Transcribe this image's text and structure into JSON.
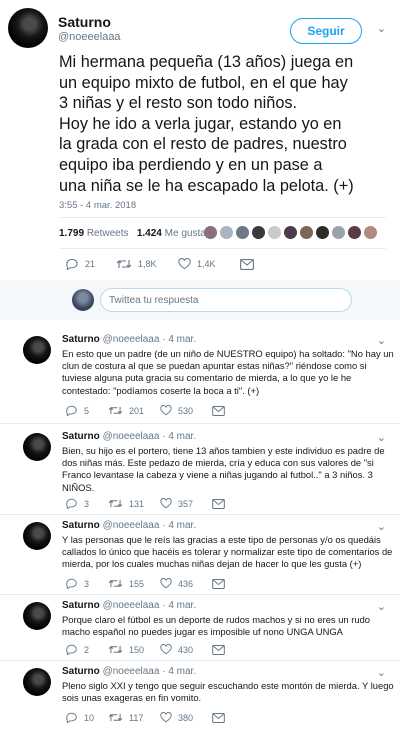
{
  "main_tweet": {
    "name": "Saturno",
    "handle": "@noeeelaaa",
    "follow_label": "Seguir",
    "text_lines": [
      "Mi hermana pequeña (13 años) juega en",
      "un equipo mixto de futbol, en el que hay",
      "3 niñas y el resto son todo niños.",
      "Hoy he ido a verla jugar, estando yo en",
      "la grada con el resto de padres, nuestro",
      "equipo iba perdiendo y en un pase a",
      "una niña se le ha escapado la pelota. (+)"
    ],
    "timestamp": "3:55 - 4 mar. 2018",
    "retweets_count": "1.799",
    "retweets_label": "Retweets",
    "likes_count": "1.424",
    "likes_label": "Me gusta",
    "liker_colors": [
      "#8a6f7d",
      "#a9b4c0",
      "#6b7a86",
      "#3a3a3a",
      "#c9c9c9",
      "#4d3b4a",
      "#7d6558",
      "#2c2c2c",
      "#9aa3ad",
      "#5a3c44",
      "#b08a80"
    ],
    "actions": {
      "replies": "21",
      "retweets": "1,8K",
      "likes": "1,4K"
    }
  },
  "reply_box": {
    "placeholder": "Twittea tu respuesta"
  },
  "replies": [
    {
      "name": "Saturno",
      "handle": "@noeeelaaa · 4 mar.",
      "lines": [
        "En esto que un padre (de un niño de NUESTRO equipo) ha soltado: \"No hay un",
        "clun de costura al que se puedan apuntar estas niñas?\" riéndose como si",
        "tuviese alguna puta gracia su comentario de mierda, a lo que yo le he",
        "contestado: \"podíamos coserte la boca a ti\". (+)"
      ],
      "replies": "5",
      "retweets": "201",
      "likes": "530"
    },
    {
      "name": "Saturno",
      "handle": "@noeeelaaa · 4 mar.",
      "lines": [
        "Bien, su hijo es el portero, tiene 13 años tambien y este individuo es padre de",
        "dos niñas más. Este pedazo de mierda, cría y educa con sus valores de \"si",
        "Franco levantase la cabeza y viene a niñas jugando al futbol..\" a 3 niños. 3",
        "NIÑOS."
      ],
      "replies": "3",
      "retweets": "131",
      "likes": "357"
    },
    {
      "name": "Saturno",
      "handle": "@noeeelaaa · 4 mar.",
      "lines": [
        "Y las personas que le reís las gracias a este tipo de personas y/o os quedáis",
        "callados lo único que hacéis es tolerar y normalizar este tipo de comentarios de",
        "mierda, por los cuales muchas niñas dejan de hacer lo que les gusta (+)"
      ],
      "replies": "3",
      "retweets": "155",
      "likes": "436"
    },
    {
      "name": "Saturno",
      "handle": "@noeeelaaa · 4 mar.",
      "lines": [
        "Porque claro el fútbol es un deporte de rudos machos y si no eres un rudo",
        "macho español no puedes jugar es imposible uf nono UNGA UNGA"
      ],
      "replies": "2",
      "retweets": "150",
      "likes": "430"
    },
    {
      "name": "Saturno",
      "handle": "@noeeelaaa · 4 mar.",
      "lines": [
        "Pleno siglo XXI y tengo que seguir escuchando este montón de mierda. Y luego",
        "sois unas exageras en fin vomito."
      ],
      "replies": "10",
      "retweets": "117",
      "likes": "380"
    }
  ]
}
